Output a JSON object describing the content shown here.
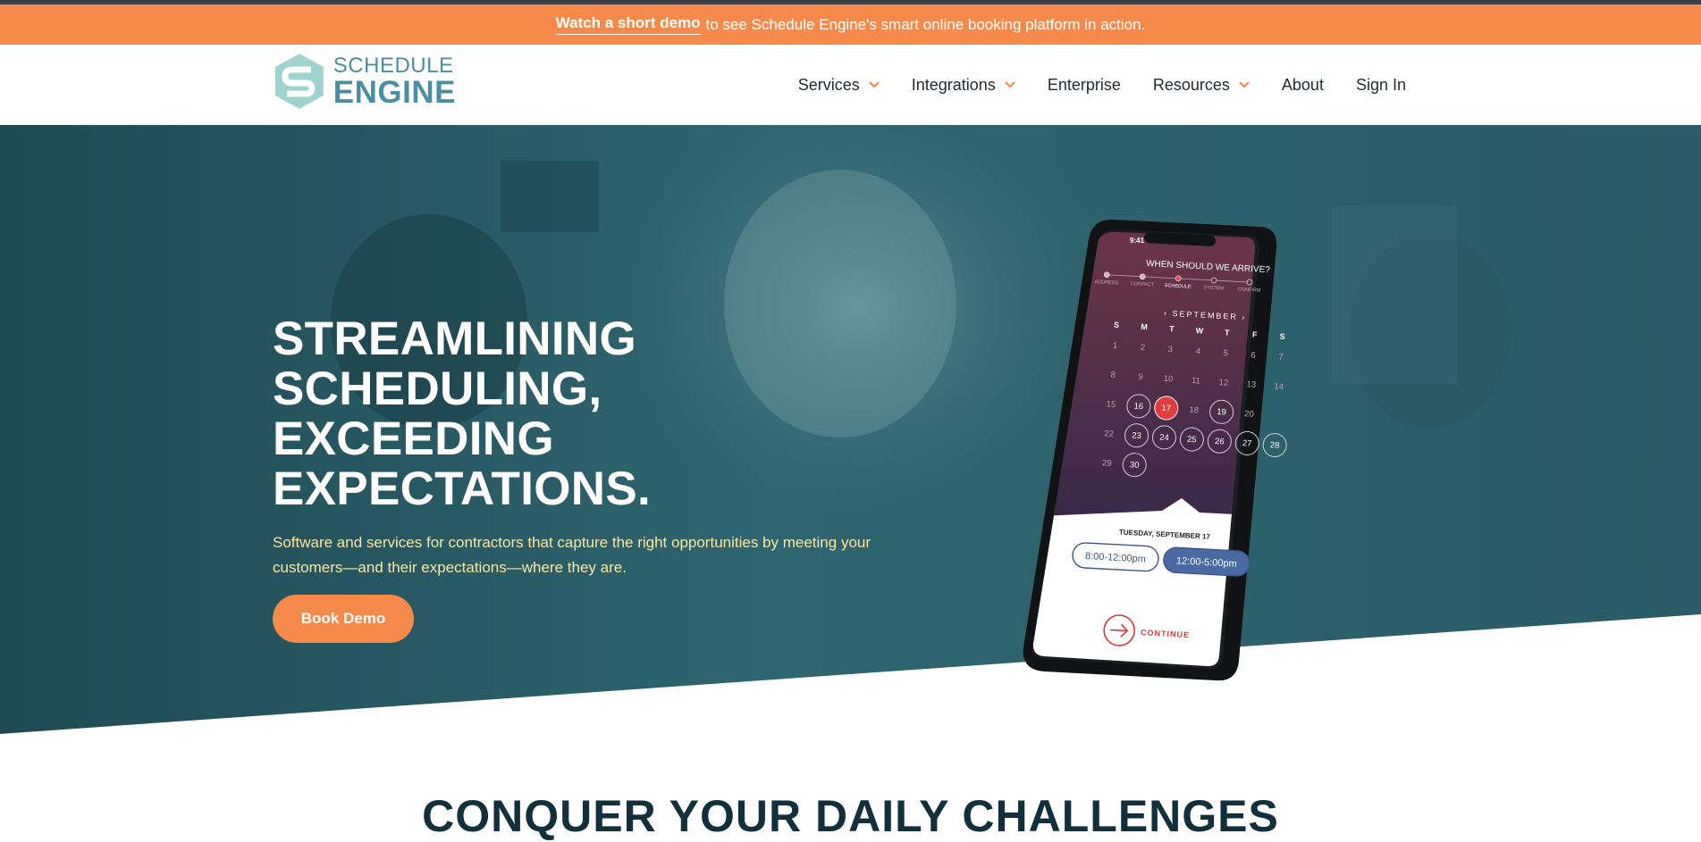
{
  "banner": {
    "link_text": "Watch a short demo",
    "rest_text": "to see Schedule Engine's smart online booking platform in action.",
    "bg_color": "#f58a4b"
  },
  "logo": {
    "line1": "SCHEDULE",
    "line2": "ENGINE",
    "icon": "schedule-engine-logo-icon"
  },
  "nav": {
    "services": "Services",
    "integrations": "Integrations",
    "enterprise": "Enterprise",
    "resources": "Resources",
    "about": "About",
    "sign_in": "Sign In",
    "chevron_icon": "chevron-down-icon"
  },
  "hero": {
    "title_lines": [
      "STREAMLINING",
      "SCHEDULING,",
      "EXCEEDING",
      "EXPECTATIONS."
    ],
    "subtitle_line1": "Software and services for contractors that capture the right opportunities by meeting your",
    "subtitle_line2": "customers—and their expectations—where they are.",
    "cta": "Book Demo",
    "overlay_color": "#2d5f6a"
  },
  "phone": {
    "time": "9:41",
    "question": "WHEN SHOULD WE ARRIVE?",
    "steps": [
      "ADDRESS",
      "CONTACT",
      "SCHEDULE",
      "SYSTEM",
      "CONFIRM"
    ],
    "month": "SEPTEMBER",
    "weekdays": [
      "S",
      "M",
      "T",
      "W",
      "T",
      "F",
      "S"
    ],
    "weeks": [
      [
        "1",
        "2",
        "3",
        "4",
        "5",
        "6",
        "7"
      ],
      [
        "8",
        "9",
        "10",
        "11",
        "12",
        "13",
        "14"
      ],
      [
        "15",
        "16",
        "17",
        "18",
        "19",
        "20"
      ],
      [
        "22",
        "23",
        "24",
        "25",
        "26",
        "27",
        "28"
      ],
      [
        "29",
        "30"
      ]
    ],
    "selected_date": "TUESDAY, SEPTEMBER 17",
    "slot1": "8:00-12:00pm",
    "slot2": "12:00-5:00pm",
    "continue": "CONTINUE"
  },
  "section": {
    "title": "CONQUER YOUR DAILY CHALLENGES"
  }
}
